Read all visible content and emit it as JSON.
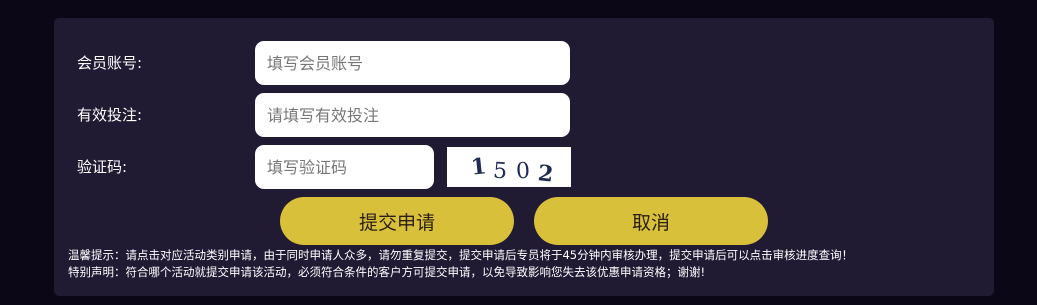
{
  "form": {
    "member_label": "会员账号:",
    "member_placeholder": "填写会员账号",
    "bet_label": "有效投注:",
    "bet_placeholder": "请填写有效投注",
    "captcha_label": "验证码:",
    "captcha_placeholder": "填写验证码",
    "captcha_digits": [
      "1",
      "5",
      "0",
      "2"
    ]
  },
  "buttons": {
    "submit_label": "提交申请",
    "cancel_label": "取消"
  },
  "notices": {
    "tip": "温馨提示：请点击对应活动类别申请，由于同时申请人众多，请勿重复提交，提交申请后专员将于45分钟内审核办理，提交申请后可以点击审核进度查询！",
    "statement": "特别声明：符合哪个活动就提交申请该活动，必须符合条件的客户方可提交申请，以免导致影响您失去该优惠申请资格；谢谢!"
  },
  "colors": {
    "page_bg": "#0c0716",
    "panel_bg": "#201a33",
    "button_bg": "#d8c03b"
  }
}
